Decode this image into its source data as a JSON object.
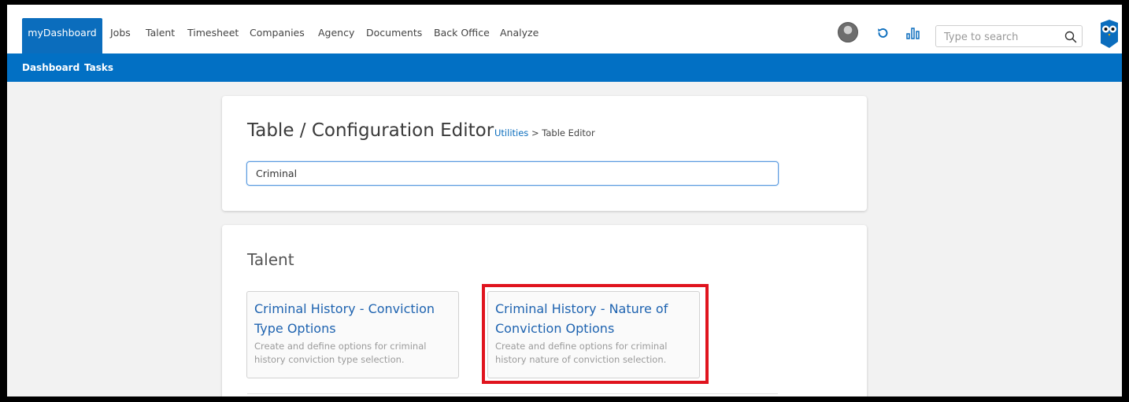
{
  "nav": {
    "active": "myDashboard",
    "items": [
      "Jobs",
      "Talent",
      "Timesheet",
      "Companies",
      "Agency",
      "Documents",
      "Back Office",
      "Analyze"
    ],
    "search_placeholder": "Type to search"
  },
  "subnav": {
    "items": [
      "Dashboard",
      "Tasks"
    ]
  },
  "editor": {
    "title": "Table / Configuration Editor",
    "breadcrumb_link": "Utilities",
    "breadcrumb_separator": ">",
    "breadcrumb_current": "Table Editor",
    "filter_value": "Criminal"
  },
  "section": {
    "title": "Talent",
    "tiles": [
      {
        "title": "Criminal History - Conviction Type Options",
        "description": "Create and define options for criminal history conviction type selection."
      },
      {
        "title": "Criminal History - Nature of Conviction Options",
        "description": "Create and define options for criminal history nature of conviction selection."
      }
    ]
  },
  "colors": {
    "brand_blue": "#0b6dbd",
    "subnav_blue": "#0270c4",
    "highlight_red": "#e0141e",
    "tile_title": "#1e63b0"
  },
  "icons": [
    "avatar",
    "refresh-icon",
    "bar-chart-icon",
    "search-icon",
    "owl-logo"
  ]
}
